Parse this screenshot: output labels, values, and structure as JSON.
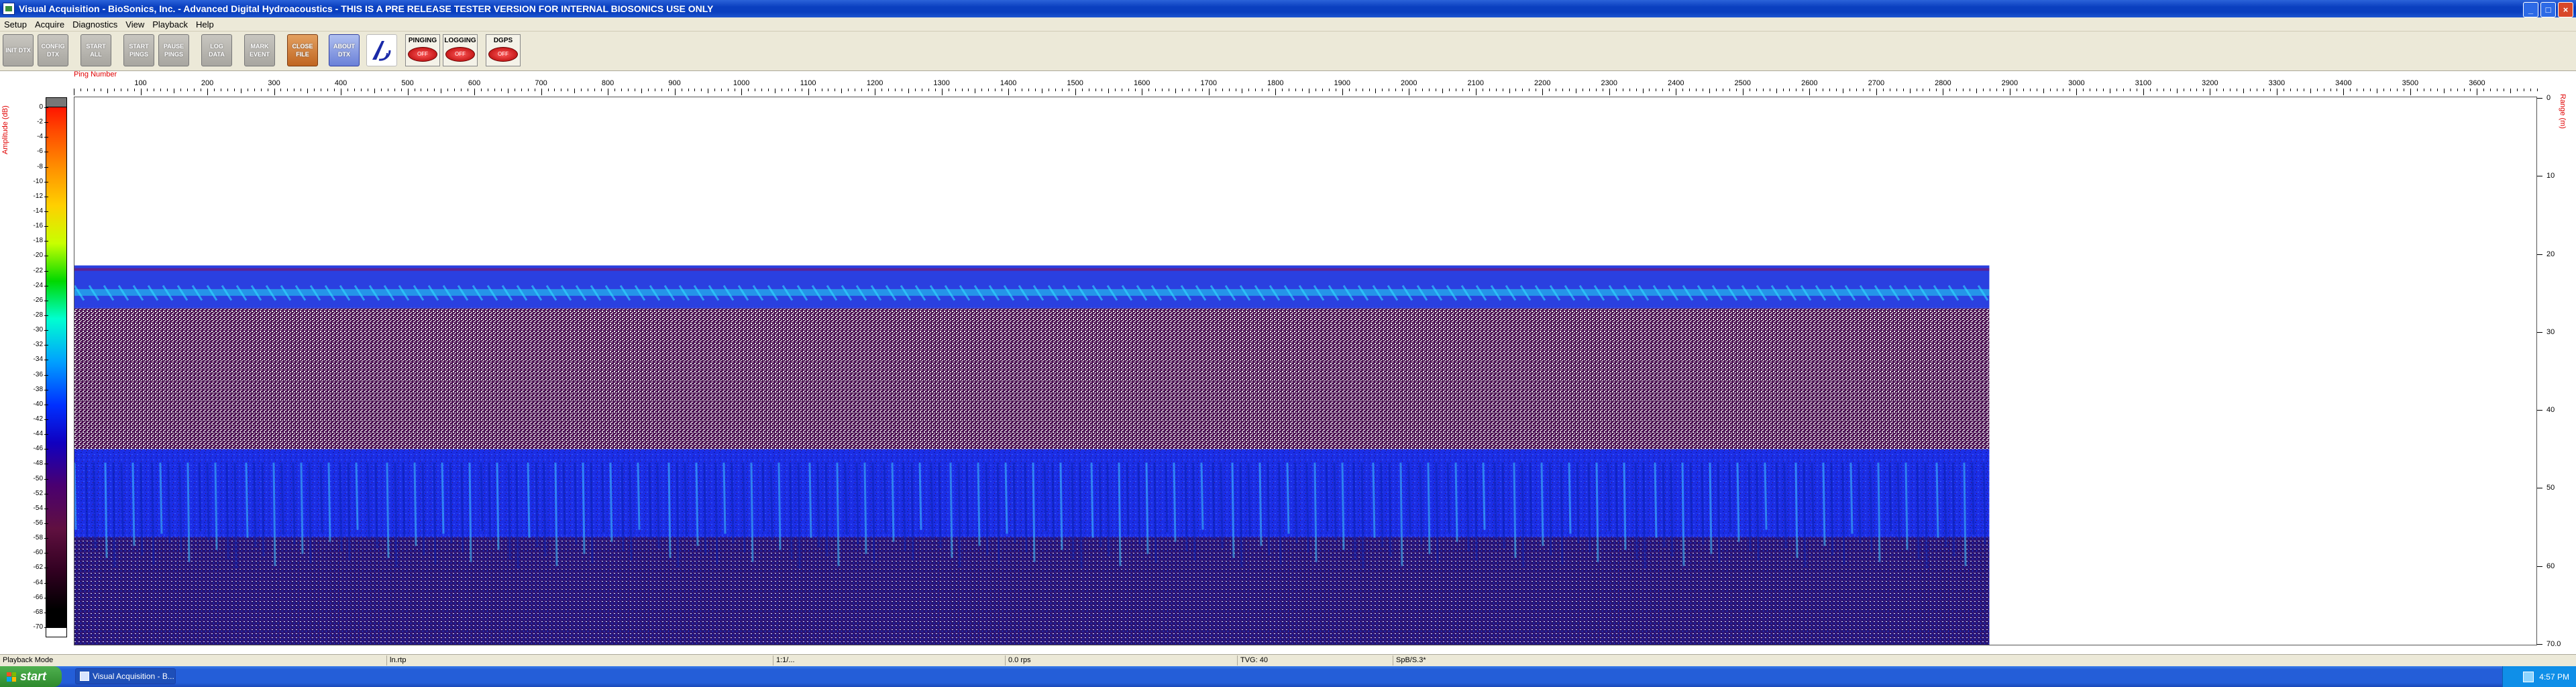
{
  "window": {
    "title": "Visual Acquisition  -  BioSonics, Inc.  -  Advanced Digital Hydroacoustics  -  THIS IS A PRE RELEASE TESTER VERSION FOR INTERNAL BIOSONICS USE ONLY",
    "minimize": "_",
    "maximize": "□",
    "close": "×"
  },
  "menu": [
    "Setup",
    "Acquire",
    "Diagnostics",
    "View",
    "Playback",
    "Help"
  ],
  "toolbar": {
    "buttons": [
      {
        "name": "init-dtx-button",
        "label": "INIT DTX"
      },
      {
        "name": "config-dtx-button",
        "label": "CONFIG DTX"
      },
      {
        "name": "start-all-button",
        "label": "START ALL"
      },
      {
        "name": "start-pings-button",
        "label": "START PINGS"
      },
      {
        "name": "pause-pings-button",
        "label": "PAUSE PINGS"
      },
      {
        "name": "log-data-button",
        "label": "LOG DATA"
      },
      {
        "name": "mark-event-button",
        "label": "MARK EVENT"
      },
      {
        "name": "close-file-button",
        "label": "CLOSE FILE"
      },
      {
        "name": "about-dtx-button",
        "label": "ABOUT DTX"
      }
    ],
    "indicators": [
      {
        "name": "pinging-indicator",
        "label": "PINGING",
        "state": "OFF"
      },
      {
        "name": "logging-indicator",
        "label": "LOGGING",
        "state": "OFF"
      },
      {
        "name": "dgps-indicator",
        "label": "DGPS",
        "state": "OFF"
      }
    ]
  },
  "echogram": {
    "x_axis_title": "Ping Number",
    "x_ticks": [
      100,
      200,
      300,
      400,
      500,
      600,
      700,
      800,
      900,
      1000,
      1100,
      1200,
      1300,
      1400,
      1500,
      1600,
      1700,
      1800,
      1900,
      2000,
      2100,
      2200,
      2300,
      2400,
      2500,
      2600,
      2700,
      2800,
      2900,
      3000,
      3100,
      3200,
      3300,
      3400,
      3500,
      3600
    ],
    "x_max": 3690,
    "pings_displayed": 2870,
    "amplitude_label": "Amplitude (dB)",
    "amplitude_ticks": [
      "0",
      "-2",
      "-4",
      "-6",
      "-8",
      "-10",
      "-12",
      "-14",
      "-16",
      "-18",
      "-20",
      "-22",
      "-24",
      "-26",
      "-28",
      "-30",
      "-32",
      "-34",
      "-36",
      "-38",
      "-40",
      "-42",
      "-44",
      "-46",
      "-48",
      "-50",
      "-52",
      "-54",
      "-56",
      "-58",
      "-60",
      "-62",
      "-64",
      "-66",
      "-68",
      "-70"
    ],
    "range_label": "Range (m)",
    "range_ticks": [
      "0",
      "10",
      "20",
      "30",
      "40",
      "50",
      "60",
      "70.0"
    ],
    "range_max": 70,
    "data_start_range_m": 21.5,
    "strong_band_end_m": 27,
    "speckle_band_end_m": 45,
    "colors": {
      "surface_band": "#2a40e0",
      "speckle": "#ffffff",
      "speckle_dark": "#4a1050",
      "deep_band": "#1b2ee6",
      "highlight": "#20d8f0"
    }
  },
  "status": {
    "mode": "Playback Mode",
    "file": "ln.rtp",
    "cell3": "1:1/...",
    "rate": "0.0 rps",
    "tvg": "TVG: 40",
    "spb": "SpB/S.3*"
  },
  "taskbar": {
    "start": "start",
    "task": "Visual Acquisition - B...",
    "clock": "4:57 PM"
  }
}
